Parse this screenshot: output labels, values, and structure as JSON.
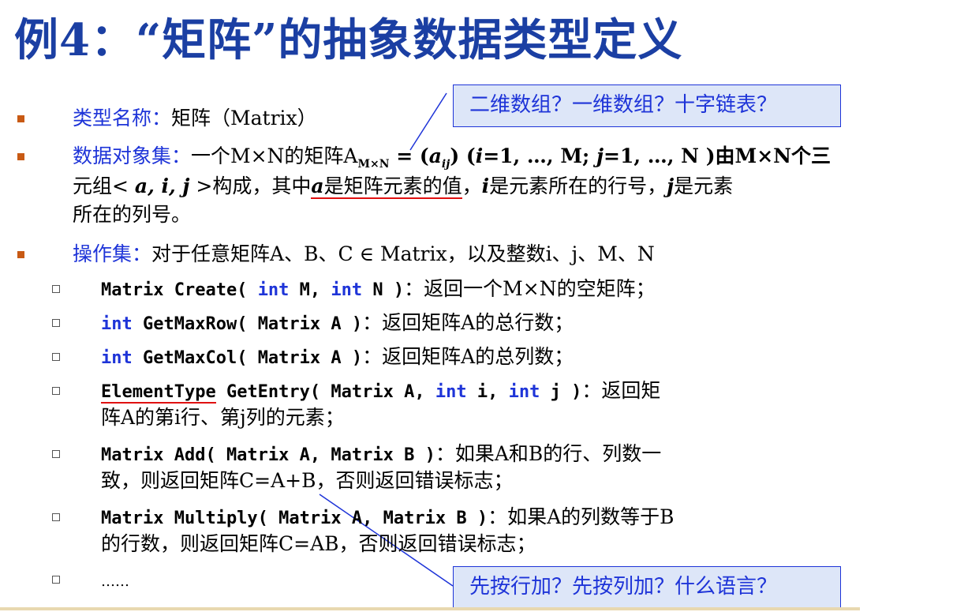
{
  "title": "例4：“矩阵”的抽象数据类型定义",
  "callouts": {
    "top": "二维数组？一维数组？十字链表？",
    "bottom": "先按行加？先按列加？什么语言？"
  },
  "type_name": {
    "label": "类型名称：",
    "text": "矩阵（Matrix）"
  },
  "data_set": {
    "label": "数据对象集：",
    "line1_a": "一个M×N的矩阵A",
    "sub1": "M×N",
    "line1_b": " = (",
    "a": "a",
    "ij": "ij",
    "line1_c": ")  (",
    "i": "i",
    "line1_d": "=1, …, M; ",
    "j": "j",
    "line1_e": "=1, …, N )由M×N个三",
    "line2_a": "元组< ",
    "tuple": "a, i, j",
    "line2_b": " >构成，其中",
    "a2": "a",
    "line2_c": "是矩阵元素的值",
    "line2_d": "，",
    "i2": "i",
    "line2_e": "是元素所在的行号，",
    "j2": "j",
    "line2_f": "是元素",
    "line3": "所在的列号。"
  },
  "ops": {
    "label": "操作集：",
    "text": "对于任意矩阵A、B、C ∈ Matrix，以及整数i、j、M、N",
    "items": [
      {
        "pre": "Matrix Create( ",
        "kw1": "int",
        "mid1": " M, ",
        "kw2": "int",
        "mid2": " N )",
        "desc": "：返回一个M×N的空矩阵；"
      },
      {
        "kw": "int",
        "sig": " GetMaxRow( Matrix A )",
        "desc": "：返回矩阵A的总行数；"
      },
      {
        "kw": "int",
        "sig": " GetMaxCol( Matrix A )",
        "desc": "：返回矩阵A的总列数；"
      },
      {
        "type": "ElementType",
        "sig": " GetEntry( Matrix A, ",
        "kw1": "int",
        "mid": " i, ",
        "kw2": "int",
        "end": " j )",
        "desc": "：返回矩",
        "desc2": "阵A的第i行、第j列的元素；"
      },
      {
        "sig": "Matrix Add( Matrix A, Matrix B )",
        "desc": "：如果A和B的行、列数一",
        "desc2": "致，则返回矩阵C=A+B，否则返回错误标志；"
      },
      {
        "sig": "Matrix Multiply( Matrix A, Matrix B )",
        "desc": "：如果A的列数等于B",
        "desc2": "的行数，则返回矩阵C=AB，否则返回错误标志；"
      },
      {
        "sig": "……"
      }
    ]
  },
  "colors": {
    "title": "#1b3fa3",
    "keyword": "#1e34d8",
    "bullet": "#c85a14",
    "underline": "#e01010",
    "callout_bg": "#dde6f8"
  }
}
